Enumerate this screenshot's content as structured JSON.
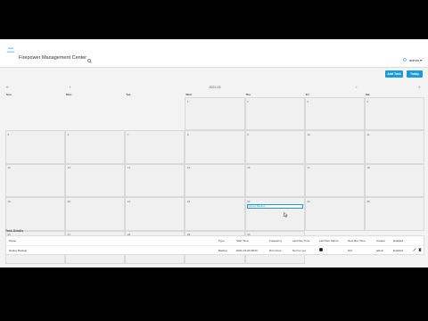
{
  "app": {
    "logo_text": "cisco",
    "title": "Firepower Management Center",
    "user": "admin ▾"
  },
  "toolbar": {
    "add_task": "Add Task",
    "today": "Today"
  },
  "calendar": {
    "month": "2021-03",
    "nav_prev_year": "«",
    "nav_prev_month": "‹",
    "nav_next_month": "›",
    "nav_next_year": "»",
    "weekdays": [
      "Sun",
      "Mon",
      "Tue",
      "Wed",
      "Thu",
      "Fri",
      "Sat"
    ],
    "weeks": [
      [
        "",
        "",
        "",
        "1",
        "2",
        "3",
        "4"
      ],
      [
        "5",
        "6",
        "7",
        "8",
        "9",
        "10",
        "11"
      ],
      [
        "12",
        "13",
        "14",
        "15",
        "16",
        "17",
        "18"
      ],
      [
        "19",
        "20",
        "21",
        "22",
        "23",
        "24",
        "25"
      ],
      [
        "26",
        "27",
        "28",
        "29",
        "30",
        "",
        ""
      ]
    ],
    "event": {
      "label": "Deploy Backup"
    }
  },
  "task_details": {
    "heading": "Task Details",
    "columns": [
      "Name",
      "Type",
      "Start Time",
      "Frequency",
      "Last Run Time",
      "Last Run Status",
      "Next Run Time",
      "Creator",
      "Enabled"
    ],
    "row": {
      "name": "Deploy Backup",
      "type": "Backup",
      "start": "2021-03-23 08:00",
      "frequency": "Run Once",
      "last_run": "Not run yet",
      "status": "",
      "next_run": "N/A",
      "creator": "admin",
      "enabled": "Enabled"
    }
  }
}
